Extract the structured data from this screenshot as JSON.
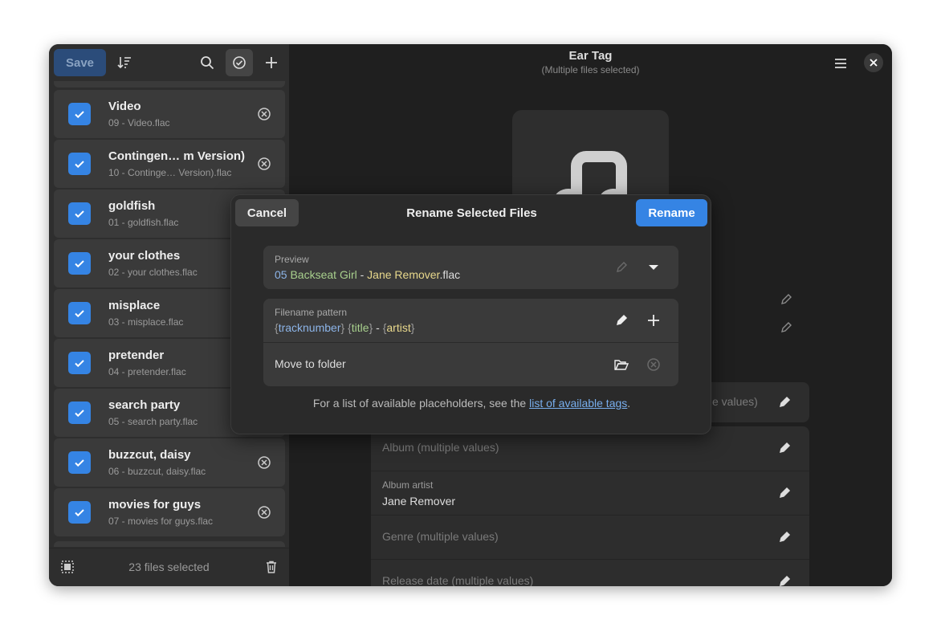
{
  "sidebar": {
    "save_label": "Save",
    "files": [
      {
        "title": "Video",
        "filename": "09 - Video.flac"
      },
      {
        "title": "Contingen…  m Version)",
        "filename": "10 - Continge…     Version).flac"
      },
      {
        "title": "goldfish",
        "filename": "01 - goldfish.flac"
      },
      {
        "title": "your clothes",
        "filename": "02 - your clothes.flac"
      },
      {
        "title": "misplace",
        "filename": "03 - misplace.flac"
      },
      {
        "title": "pretender",
        "filename": "04 - pretender.flac"
      },
      {
        "title": "search party",
        "filename": "05 - search party.flac"
      },
      {
        "title": "buzzcut, daisy",
        "filename": "06 - buzzcut, daisy.flac"
      },
      {
        "title": "movies for guys",
        "filename": "07 - movies for guys.flac"
      }
    ],
    "selected_count": "23 files selected"
  },
  "header": {
    "title": "Ear Tag",
    "subtitle": "(Multiple files selected)"
  },
  "fields": {
    "partial_placeholder": "e values)",
    "album_placeholder": "Album (multiple values)",
    "album_artist_label": "Album artist",
    "album_artist_value": "Jane Remover",
    "genre_placeholder": "Genre (multiple values)",
    "release_date_placeholder": "Release date (multiple values)"
  },
  "dialog": {
    "cancel_label": "Cancel",
    "title": "Rename Selected Files",
    "rename_label": "Rename",
    "preview_label": "Preview",
    "preview": {
      "num": "05",
      "space": " ",
      "title": "Backseat Girl",
      "sep": " - ",
      "artist": "Jane Remover",
      "ext": ".flac"
    },
    "pattern_label": "Filename pattern",
    "pattern": {
      "ob1": "{",
      "tracknumber": "tracknumber",
      "cb1": "}",
      "space": " ",
      "ob2": "{",
      "title": "title",
      "cb2": "}",
      "sep": " - ",
      "ob3": "{",
      "artist": "artist",
      "cb3": "}"
    },
    "move_label": "Move to folder",
    "help_prefix": "For a list of available placeholders, see the ",
    "help_link": "list of available tags",
    "help_suffix": "."
  },
  "colors": {
    "accent": "#3584e4",
    "num": "#8cb4e8",
    "title": "#a8d08d",
    "artist": "#e8d88c"
  }
}
